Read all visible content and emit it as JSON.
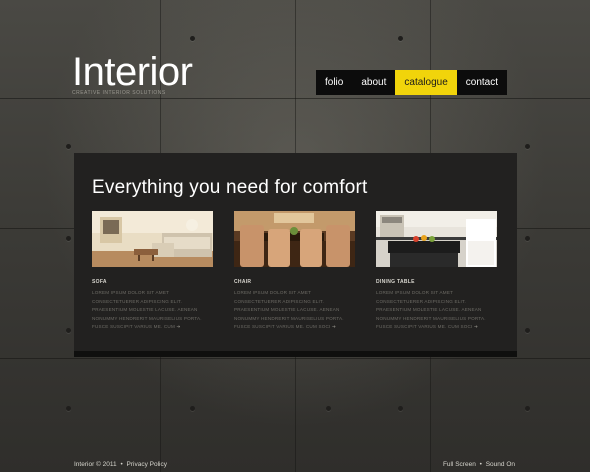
{
  "header": {
    "logo_title": "Interior",
    "logo_tagline": "Creative interior solutions"
  },
  "nav": {
    "items": [
      {
        "label": "folio"
      },
      {
        "label": "about"
      },
      {
        "label": "catalogue",
        "active": true
      },
      {
        "label": "contact"
      }
    ],
    "accent_color": "#f1d40b"
  },
  "panel": {
    "title": "Everything you need for comfort",
    "items": [
      {
        "name": "Sofa",
        "description": "Lorem ipsum dolor sit amet consectetuerer adipiscing elit. Praesentium molestie lacuse. Aenean nonummy hendrerit mauriselius porta. Fusce suscipit varius me. Cum",
        "image_icon": "living-room-photo"
      },
      {
        "name": "Chair",
        "description": "Lorem ipsum dolor sit amet consectetuerer adipiscing elit. Praesentium molestie lacuse. Aenean nonummy hendrerit mauriselius porta. Fusce suscipit varius me. Cum soci",
        "image_icon": "dining-chairs-photo"
      },
      {
        "name": "Dining table",
        "description": "Lorem ipsum dolor sit amet consectetuerer adipiscing elit. Praesentium molestie lacuse. Aenean nonummy hendrerit mauriselius porta. Fusce suscipit varius me. Cum soci",
        "image_icon": "kitchen-photo"
      }
    ]
  },
  "footer": {
    "brand": "Interior",
    "copyright": "© 2011",
    "privacy": "Privacy Policy",
    "full_screen": "Full Screen",
    "sound": "Sound On"
  }
}
